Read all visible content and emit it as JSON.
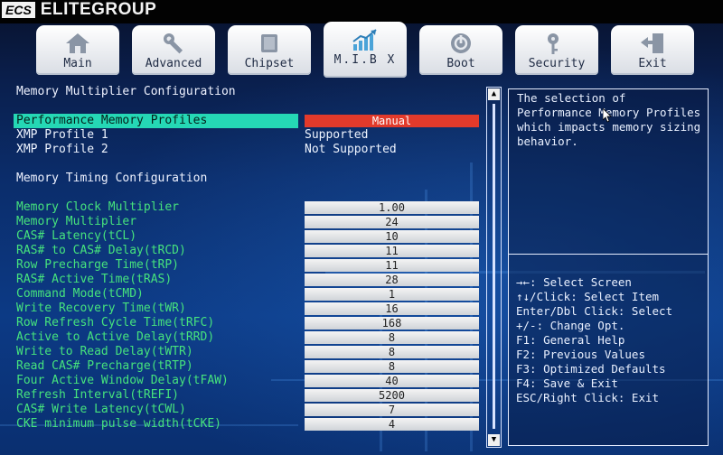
{
  "brand": {
    "logo": "ECS",
    "name": "ELITEGROUP"
  },
  "tabs": [
    {
      "label": "Main",
      "icon": "house-icon"
    },
    {
      "label": "Advanced",
      "icon": "wrench-icon"
    },
    {
      "label": "Chipset",
      "icon": "chip-icon"
    },
    {
      "label": "M.I.B X",
      "icon": "growth-chart-icon",
      "active": true
    },
    {
      "label": "Boot",
      "icon": "power-icon"
    },
    {
      "label": "Security",
      "icon": "key-icon"
    },
    {
      "label": "Exit",
      "icon": "exit-door-icon"
    }
  ],
  "main": {
    "section1": "Memory Multiplier Configuration",
    "profiles": [
      {
        "label": "Performance Memory Profiles",
        "value": "Manual"
      },
      {
        "label": "XMP Profile 1",
        "value": "Supported"
      },
      {
        "label": "XMP Profile 2",
        "value": "Not Supported"
      }
    ],
    "section2": "Memory Timing Configuration",
    "timings": [
      {
        "label": "Memory Clock Multiplier",
        "value": "1.00"
      },
      {
        "label": "Memory Multiplier",
        "value": "24"
      },
      {
        "label": "CAS# Latency(tCL)",
        "value": "10"
      },
      {
        "label": "RAS# to CAS# Delay(tRCD)",
        "value": "11"
      },
      {
        "label": "Row Precharge Time(tRP)",
        "value": "11"
      },
      {
        "label": "RAS# Active Time(tRAS)",
        "value": "28"
      },
      {
        "label": "Command Mode(tCMD)",
        "value": "1"
      },
      {
        "label": "Write Recovery Time(tWR)",
        "value": "16"
      },
      {
        "label": "Row Refresh Cycle Time(tRFC)",
        "value": "168"
      },
      {
        "label": "Active to Active Delay(tRRD)",
        "value": "8"
      },
      {
        "label": "Write to Read Delay(tWTR)",
        "value": "8"
      },
      {
        "label": "Read CAS# Precharge(tRTP)",
        "value": "8"
      },
      {
        "label": "Four Active Window Delay(tFAW)",
        "value": "40"
      },
      {
        "label": "Refresh Interval(tREFI)",
        "value": "5200"
      },
      {
        "label": "CAS# Write Latency(tCWL)",
        "value": "7"
      },
      {
        "label": "CKE minimum pulse width(tCKE)",
        "value": "4"
      }
    ]
  },
  "help": {
    "description": "The selection of Performance Memory Profiles which impacts memory sizing behavior.",
    "keys": [
      "→←: Select Screen",
      "↑↓/Click: Select Item",
      "Enter/Dbl Click: Select",
      "+/-: Change Opt.",
      "F1: General Help",
      "F2: Previous Values",
      "F3: Optimized Defaults",
      "F4: Save & Exit",
      "ESC/Right Click: Exit"
    ]
  },
  "colors": {
    "accent": "#25d8b5",
    "selected_value": "#e23a2b",
    "label_green": "#46e37d"
  }
}
